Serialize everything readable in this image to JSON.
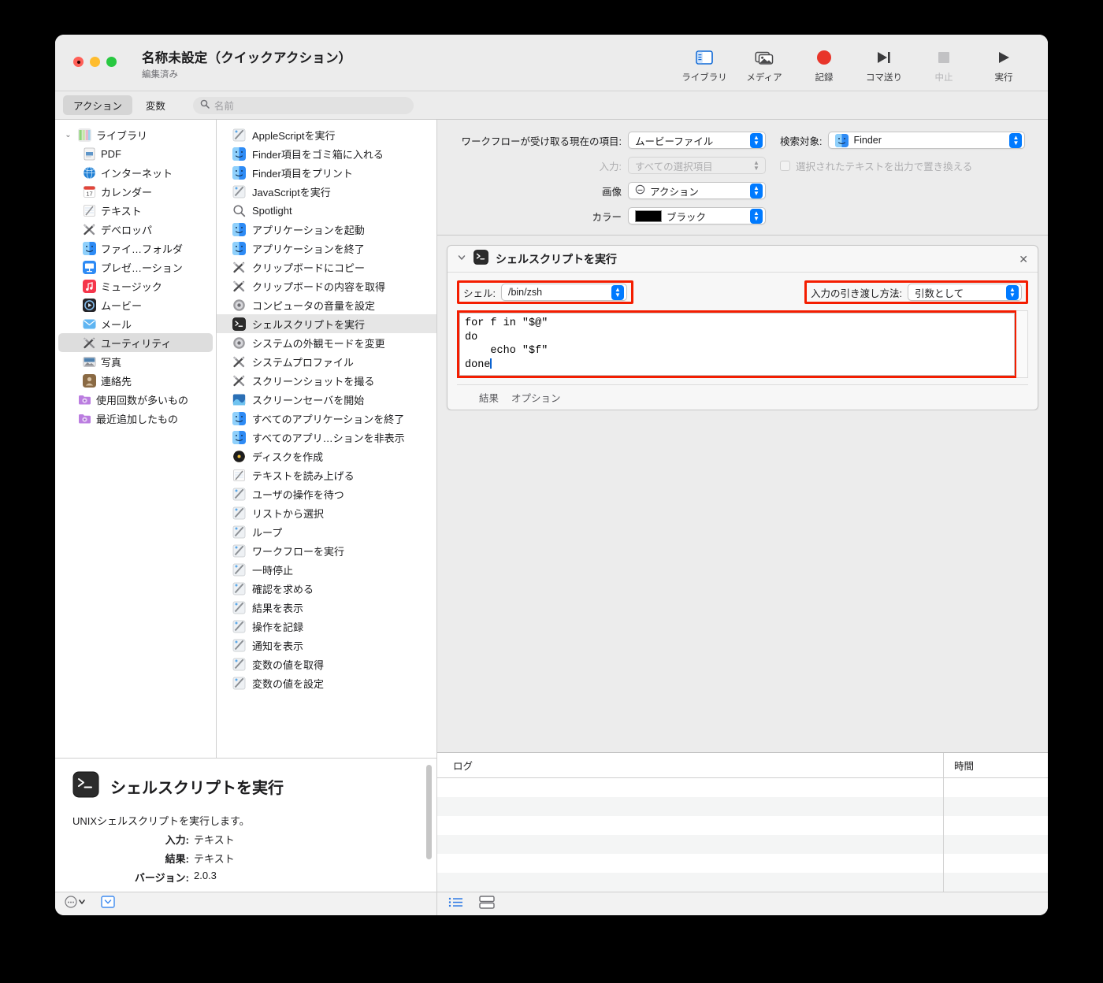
{
  "window": {
    "title": "名称未設定（クイックアクション）",
    "subtitle": "編集済み"
  },
  "toolbar": {
    "items": [
      {
        "label": "ライブラリ",
        "icon": "library-panel-icon",
        "disabled": false
      },
      {
        "label": "メディア",
        "icon": "media-photos-icon",
        "disabled": false
      },
      {
        "label": "記録",
        "icon": "record-circle-icon",
        "disabled": false
      },
      {
        "label": "コマ送り",
        "icon": "step-forward-icon",
        "disabled": false
      },
      {
        "label": "中止",
        "icon": "stop-square-icon",
        "disabled": true
      },
      {
        "label": "実行",
        "icon": "play-triangle-icon",
        "disabled": false
      }
    ]
  },
  "tabbar": {
    "tabs": [
      {
        "label": "アクション",
        "active": true
      },
      {
        "label": "変数",
        "active": false
      }
    ],
    "search_placeholder": "名前",
    "search_value": ""
  },
  "library": {
    "items": [
      {
        "label": "ライブラリ",
        "icon": "library-icon",
        "level": 0,
        "expanded": true,
        "selected": false
      },
      {
        "label": "PDF",
        "icon": "pdf-icon",
        "level": 1,
        "selected": false
      },
      {
        "label": "インターネット",
        "icon": "internet-globe-icon",
        "level": 1,
        "selected": false
      },
      {
        "label": "カレンダー",
        "icon": "calendar-icon",
        "level": 1,
        "selected": false
      },
      {
        "label": "テキスト",
        "icon": "text-icon",
        "level": 1,
        "selected": false
      },
      {
        "label": "デベロッパ",
        "icon": "developer-icon",
        "level": 1,
        "selected": false
      },
      {
        "label": "ファイ…フォルダ",
        "icon": "finder-icon",
        "level": 1,
        "selected": false
      },
      {
        "label": "プレゼ…ーション",
        "icon": "keynote-icon",
        "level": 1,
        "selected": false
      },
      {
        "label": "ミュージック",
        "icon": "music-icon",
        "level": 1,
        "selected": false
      },
      {
        "label": "ムービー",
        "icon": "quicktime-icon",
        "level": 1,
        "selected": false
      },
      {
        "label": "メール",
        "icon": "mail-icon",
        "level": 1,
        "selected": false
      },
      {
        "label": "ユーティリティ",
        "icon": "utilities-icon",
        "level": 1,
        "selected": true
      },
      {
        "label": "写真",
        "icon": "photos-icon",
        "level": 1,
        "selected": false
      },
      {
        "label": "連絡先",
        "icon": "contacts-icon",
        "level": 1,
        "selected": false
      },
      {
        "label": "使用回数が多いもの",
        "icon": "smart-folder-icon",
        "level": 0,
        "selected": false
      },
      {
        "label": "最近追加したもの",
        "icon": "smart-folder-icon",
        "level": 0,
        "selected": false
      }
    ]
  },
  "actions": {
    "items": [
      {
        "label": "AppleScriptを実行",
        "icon": "automator-script-icon",
        "selected": false
      },
      {
        "label": "Finder項目をゴミ箱に入れる",
        "icon": "finder-icon",
        "selected": false
      },
      {
        "label": "Finder項目をプリント",
        "icon": "finder-icon",
        "selected": false
      },
      {
        "label": "JavaScriptを実行",
        "icon": "automator-script-icon",
        "selected": false
      },
      {
        "label": "Spotlight",
        "icon": "spotlight-search-icon",
        "selected": false
      },
      {
        "label": "アプリケーションを起動",
        "icon": "finder-icon",
        "selected": false
      },
      {
        "label": "アプリケーションを終了",
        "icon": "finder-icon",
        "selected": false
      },
      {
        "label": "クリップボードにコピー",
        "icon": "utilities-icon",
        "selected": false
      },
      {
        "label": "クリップボードの内容を取得",
        "icon": "utilities-icon",
        "selected": false
      },
      {
        "label": "コンピュータの音量を設定",
        "icon": "sysprefs-icon",
        "selected": false
      },
      {
        "label": "シェルスクリプトを実行",
        "icon": "terminal-icon",
        "selected": true
      },
      {
        "label": "システムの外観モードを変更",
        "icon": "sysprefs-icon",
        "selected": false
      },
      {
        "label": "システムプロファイル",
        "icon": "utilities-icon",
        "selected": false
      },
      {
        "label": "スクリーンショットを撮る",
        "icon": "utilities-icon",
        "selected": false
      },
      {
        "label": "スクリーンセーバを開始",
        "icon": "screensaver-icon",
        "selected": false
      },
      {
        "label": "すべてのアプリケーションを終了",
        "icon": "finder-icon",
        "selected": false
      },
      {
        "label": "すべてのアプリ…ションを非表示",
        "icon": "finder-icon",
        "selected": false
      },
      {
        "label": "ディスクを作成",
        "icon": "burn-disc-icon",
        "selected": false
      },
      {
        "label": "テキストを読み上げる",
        "icon": "text-icon",
        "selected": false
      },
      {
        "label": "ユーザの操作を待つ",
        "icon": "automator-script-icon",
        "selected": false
      },
      {
        "label": "リストから選択",
        "icon": "automator-script-icon",
        "selected": false
      },
      {
        "label": "ループ",
        "icon": "automator-script-icon",
        "selected": false
      },
      {
        "label": "ワークフローを実行",
        "icon": "automator-script-icon",
        "selected": false
      },
      {
        "label": "一時停止",
        "icon": "automator-script-icon",
        "selected": false
      },
      {
        "label": "確認を求める",
        "icon": "automator-script-icon",
        "selected": false
      },
      {
        "label": "結果を表示",
        "icon": "automator-script-icon",
        "selected": false
      },
      {
        "label": "操作を記録",
        "icon": "automator-script-icon",
        "selected": false
      },
      {
        "label": "通知を表示",
        "icon": "automator-script-icon",
        "selected": false
      },
      {
        "label": "変数の値を取得",
        "icon": "automator-script-icon",
        "selected": false
      },
      {
        "label": "変数の値を設定",
        "icon": "automator-script-icon",
        "selected": false
      }
    ]
  },
  "info": {
    "title": "シェルスクリプトを実行",
    "icon": "terminal-icon",
    "description": "UNIXシェルスクリプトを実行します。",
    "rows": [
      {
        "key": "入力:",
        "value": "テキスト"
      },
      {
        "key": "結果:",
        "value": "テキスト"
      },
      {
        "key": "バージョン:",
        "value": "2.0.3"
      }
    ]
  },
  "settings": {
    "receives_label": "ワークフローが受け取る現在の項目:",
    "receives_value": "ムービーファイル",
    "search_target_label": "検索対象:",
    "search_target_value": "Finder",
    "input_label": "入力:",
    "input_value": "すべての選択項目",
    "replace_checkbox_label": "選択されたテキストを出力で置き換える",
    "replace_checked": false,
    "image_label": "画像",
    "image_value": "アクション",
    "color_label": "カラー",
    "color_value": "ブラック",
    "color_hex": "#000000"
  },
  "action_card": {
    "title": "シェルスクリプトを実行",
    "close_label": "✕",
    "shell_label": "シェル:",
    "shell_value": "/bin/zsh",
    "pass_input_label": "入力の引き渡し方法:",
    "pass_input_value": "引数として",
    "script": "for f in \"$@\"\ndo\n    echo \"$f\"\ndone",
    "tabs": [
      "結果",
      "オプション"
    ]
  },
  "log": {
    "columns": [
      "ログ",
      "時間"
    ],
    "rows": []
  },
  "colors": {
    "accent": "#007aff",
    "annotation": "#f41d00",
    "record": "#e8352a",
    "selection": "#dddddd"
  }
}
